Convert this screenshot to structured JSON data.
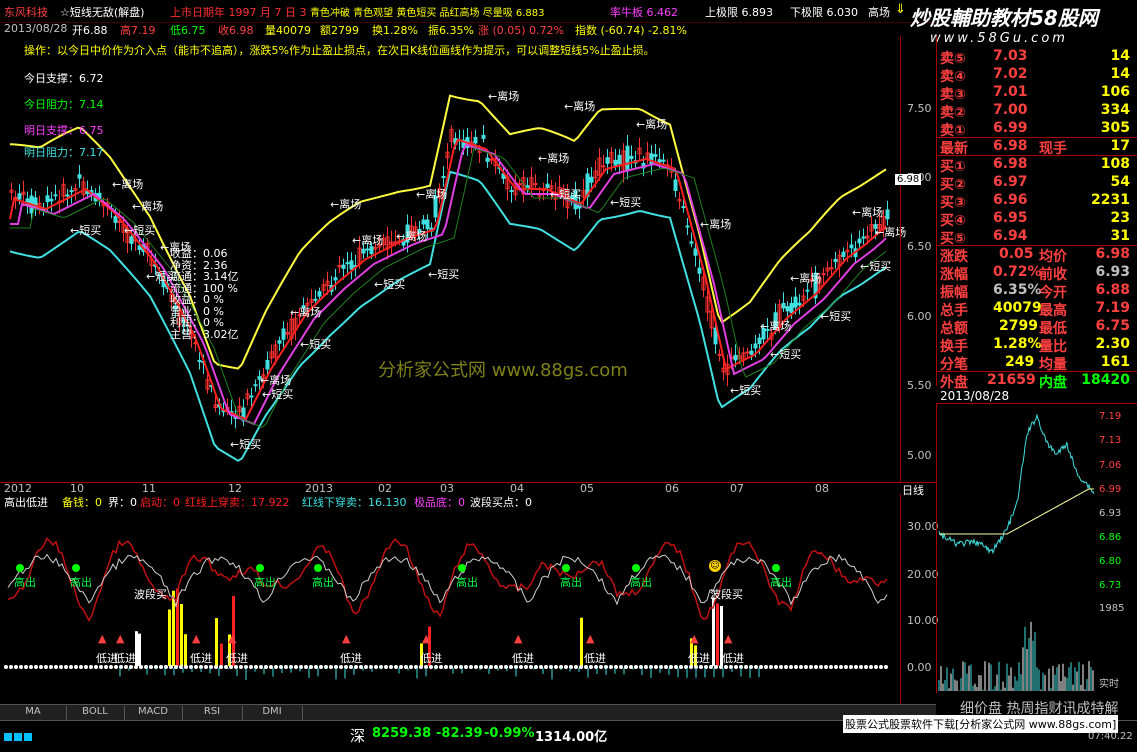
{
  "topbar": {
    "stock_name": "东风科技",
    "formula": "☆短线无敌(解盘)",
    "status1": "上市日期年 1997 月 7 日 3",
    "status2": "青色冲破 青色观望 黄色短买 品红高场 尽量吸 6.883",
    "status3": "率牛板 6.462",
    "upper_limit": "上极限 6.893",
    "lower_limit": "下极限 6.030",
    "high_field": "高场",
    "watermark": "炒股輔助教材58股网",
    "watermark_url": "www.58Gu.com"
  },
  "infobar": {
    "date": "2013/08/28",
    "open": "开6.88",
    "high": "高7.19",
    "low": "低6.75",
    "close": "收6.98",
    "volume": "量40079",
    "amount": "额2799",
    "turnover": "换1.28%",
    "amplitude": "振6.35%",
    "change": "涨 (0.05) 0.72%",
    "index": "指数 (-60.74) -2.81%"
  },
  "main": {
    "operation_text": "操作：以今日中价作为介入点（能市不追高），涨跌5%作为止盈止损点，在次日K线位画线作为提示，可以调整短线5%止盈止损。",
    "support_today": "今日支撑：6.72",
    "resist_today": "今日阻力：7.14",
    "support_tomorrow": "明日支撑：6.75",
    "resist_tomorrow": "明日阻力：7.17",
    "stats": [
      "收益：0.06",
      "净资：2.36",
      "流通：3.14亿",
      "流通：100 %",
      "收益：0 %",
      "营业：0 %",
      "利润：0 %",
      "主营：3.02亿"
    ],
    "watermark": "分析家公式网 www.88gs.com",
    "price_tag": "6.98",
    "y_labels": [
      "7.50",
      "7.00",
      "6.50",
      "6.00",
      "5.50",
      "5.00"
    ],
    "label_leave": "离场",
    "label_buy": "短买"
  },
  "dates": [
    "2012",
    "10",
    "11",
    "12",
    "2013",
    "02",
    "03",
    "04",
    "05",
    "06",
    "07",
    "08"
  ],
  "day_line": "日线",
  "indicator": {
    "name": "高出低进",
    "money": "备钱：0",
    "bound": "界：0",
    "start": "启动：0",
    "red_up": "红线上穿卖：17.922",
    "green_down": "红线下穿卖：16.130",
    "extreme": "极品底：0",
    "wave_buy": "波段买点：0",
    "y_labels": [
      "30.00",
      "20.00",
      "10.00",
      "0.00"
    ],
    "label_high_out": "高出",
    "label_low_in": "低进",
    "label_wave": "波段买"
  },
  "tabs": [
    "MA",
    "BOLL",
    "MACD",
    "RSI",
    "DMI"
  ],
  "statusbar": {
    "index_name": "深",
    "index_value": "8259.38",
    "index_change": "-82.39",
    "index_pct": "-0.99%",
    "index_amount": "1314.00亿",
    "ad_text": "股票公式股票软件下载[分析家公式网 www.88gs.com]",
    "time": "07:40.22"
  },
  "quote": {
    "sell5_label": "卖⑤",
    "sell5_price": "7.03",
    "sell5_vol": "14",
    "sell4_label": "卖④",
    "sell4_price": "7.02",
    "sell4_vol": "14",
    "sell3_label": "卖③",
    "sell3_price": "7.01",
    "sell3_vol": "106",
    "sell2_label": "卖②",
    "sell2_price": "7.00",
    "sell2_vol": "334",
    "sell1_label": "卖①",
    "sell1_price": "6.99",
    "sell1_vol": "305",
    "latest_label": "最新",
    "latest": "6.98",
    "cur_hand_label": "现手",
    "cur_hand": "17",
    "buy1_label": "买①",
    "buy1_price": "6.98",
    "buy1_vol": "108",
    "buy2_label": "买②",
    "buy2_price": "6.97",
    "buy2_vol": "54",
    "buy3_label": "买③",
    "buy3_price": "6.96",
    "buy3_vol": "2231",
    "buy4_label": "买④",
    "buy4_price": "6.95",
    "buy4_vol": "23",
    "buy5_label": "买⑤",
    "buy5_price": "6.94",
    "buy5_vol": "31",
    "chg_label": "涨跌",
    "chg": "0.05",
    "avg_label": "均价",
    "avg": "6.98",
    "pct_label": "涨幅",
    "pct": "0.72%",
    "prev_label": "前收",
    "prev": "6.93",
    "amp_label": "振幅",
    "amp": "6.35%",
    "open_label": "今开",
    "open": "6.88",
    "vol_label": "总手",
    "vol": "40079",
    "high_label": "最高",
    "high": "7.19",
    "amt_label": "总额",
    "amt": "2799",
    "low_label": "最低",
    "low": "6.75",
    "turn_label": "换手",
    "turn": "1.28%",
    "ratio_label": "量比",
    "ratio": "2.30",
    "trades_label": "分笔",
    "trades": "249",
    "avgvol_label": "均量",
    "avgvol": "161",
    "outer_label": "外盘",
    "outer": "21659",
    "inner_label": "内盘",
    "inner": "18420"
  },
  "mini": {
    "date": "2013/08/28",
    "y_labels": [
      "7.19",
      "7.13",
      "7.06",
      "6.99",
      "6.93",
      "6.86",
      "6.80",
      "6.73"
    ],
    "vol_label": "1985",
    "realtime": "实时",
    "footer": "细价盘 热周指财讯成特解"
  }
}
